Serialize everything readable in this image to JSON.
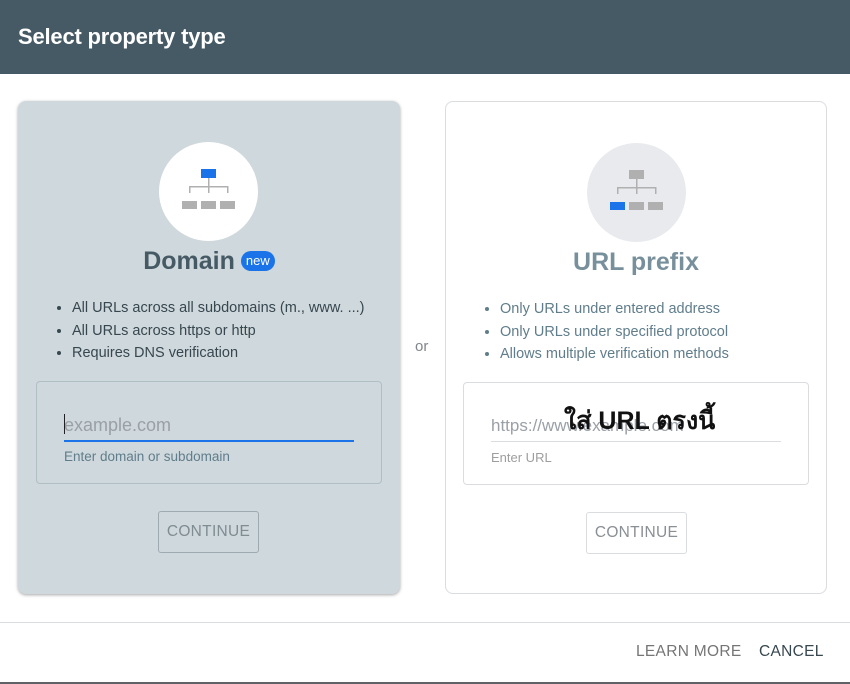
{
  "dialog": {
    "title": "Select property type"
  },
  "domain_card": {
    "title": "Domain",
    "badge": "new",
    "icon": "sitemap-icon-top-highlighted",
    "bullets": [
      "All URLs across all subdomains (m., www. ...)",
      "All URLs across https or http",
      "Requires DNS verification"
    ],
    "input_placeholder": "example.com",
    "input_value": "",
    "helper": "Enter domain or subdomain",
    "continue_label": "CONTINUE"
  },
  "separator": "or",
  "url_card": {
    "title": "URL prefix",
    "icon": "sitemap-icon-leaf-highlighted",
    "bullets": [
      "Only URLs under entered address",
      "Only URLs under specified protocol",
      "Allows multiple verification methods"
    ],
    "input_placeholder": "https://www.example.com",
    "input_value": "",
    "helper": "Enter URL",
    "annotation": "ใส่ URL ตรงนี้",
    "continue_label": "CONTINUE"
  },
  "footer": {
    "learn_more_label": "LEARN MORE",
    "cancel_label": "CANCEL"
  },
  "colors": {
    "header": "#455a64",
    "accent": "#1a73e8",
    "selected_card": "#cfd8dc",
    "icon_gray": "#b0b0b0"
  }
}
